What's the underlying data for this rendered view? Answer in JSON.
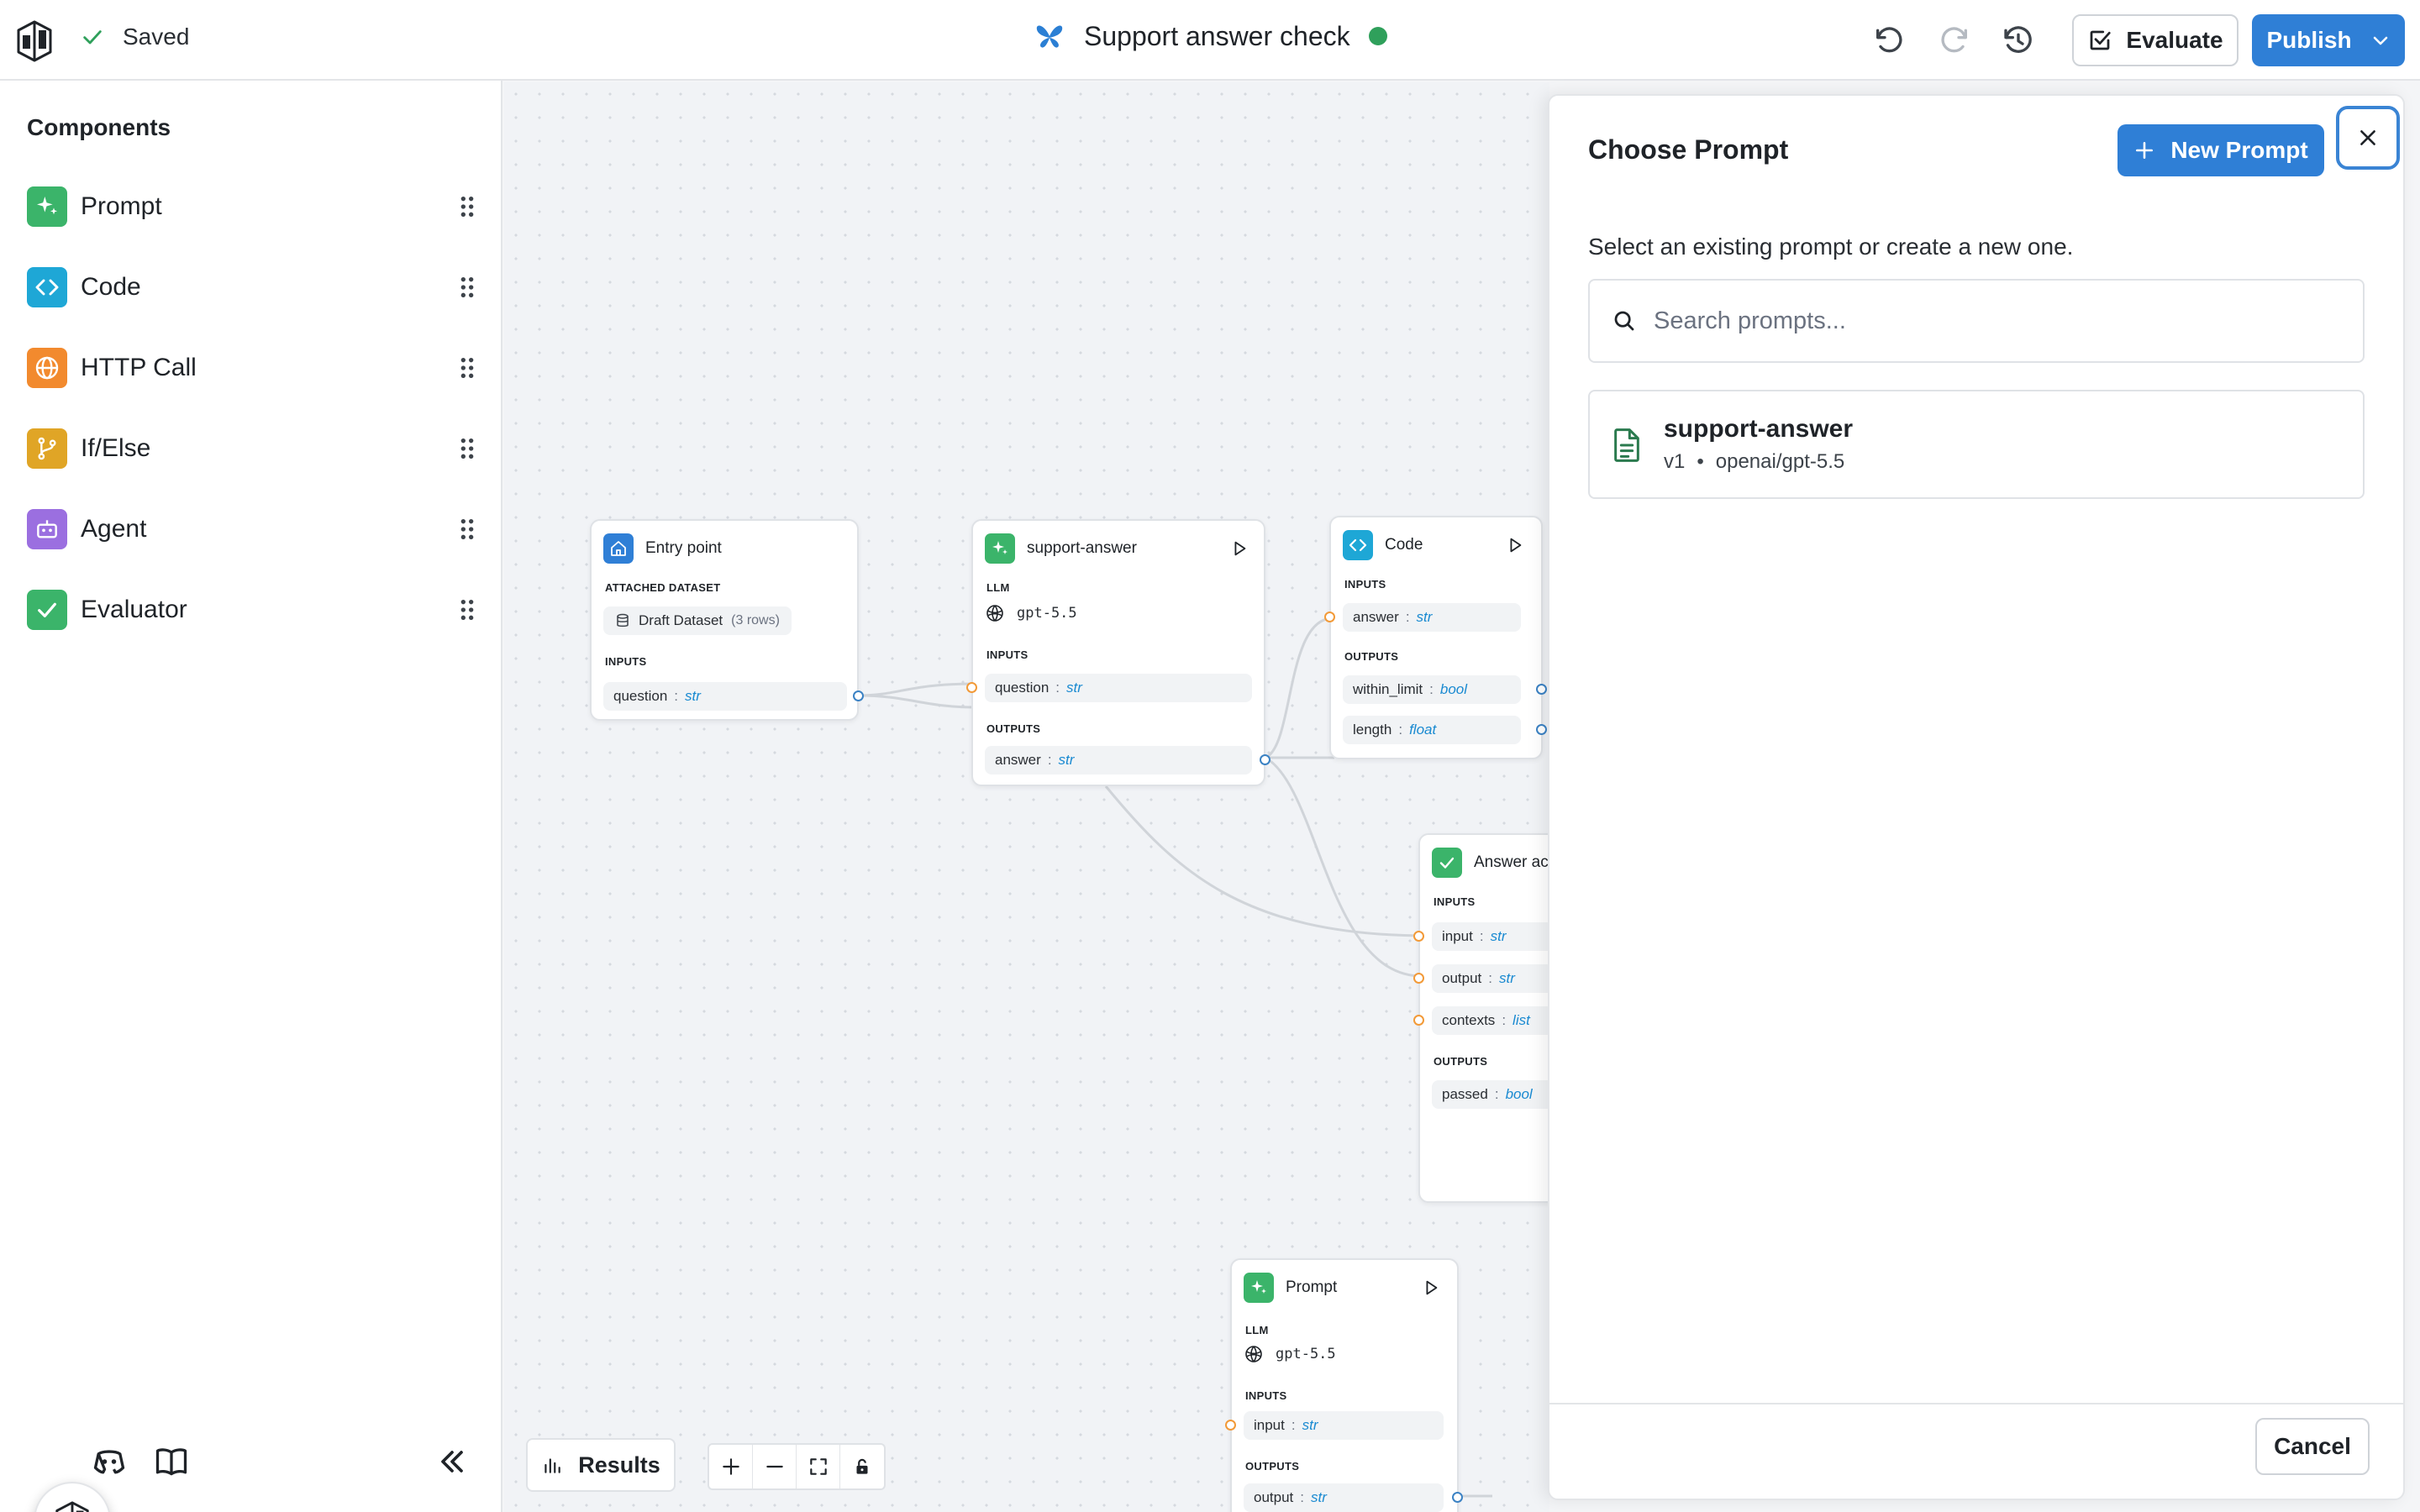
{
  "topbar": {
    "saved_label": "Saved",
    "workflow_title": "Support answer check",
    "status_color": "#2fa05b",
    "evaluate_label": "Evaluate",
    "publish_label": "Publish",
    "icons": [
      "undo-icon",
      "redo-icon",
      "history-icon"
    ]
  },
  "sidebar": {
    "title": "Components",
    "items": [
      {
        "label": "Prompt",
        "icon": "sparkle-icon",
        "color": "#3bb46a"
      },
      {
        "label": "Code",
        "icon": "code-icon",
        "color": "#1ea7d6"
      },
      {
        "label": "HTTP Call",
        "icon": "globe-icon",
        "color": "#f28a2e"
      },
      {
        "label": "If/Else",
        "icon": "branch-icon",
        "color": "#e0a526"
      },
      {
        "label": "Agent",
        "icon": "robot-icon",
        "color": "#9b6fe0"
      },
      {
        "label": "Evaluator",
        "icon": "check-icon",
        "color": "#3bb46a"
      }
    ]
  },
  "canvas": {
    "results_label": "Results",
    "nodes": {
      "entry": {
        "title": "Entry point",
        "dataset_section": "ATTACHED DATASET",
        "dataset_name": "Draft Dataset",
        "dataset_rows": "(3 rows)",
        "inputs_section": "INPUTS",
        "inputs": [
          {
            "name": "question",
            "type": "str"
          }
        ]
      },
      "support": {
        "title": "support-answer",
        "llm_section": "LLM",
        "model": "gpt-5.5",
        "inputs_section": "INPUTS",
        "inputs": [
          {
            "name": "question",
            "type": "str"
          }
        ],
        "outputs_section": "OUTPUTS",
        "outputs": [
          {
            "name": "answer",
            "type": "str"
          }
        ]
      },
      "code": {
        "title": "Code",
        "inputs_section": "INPUTS",
        "inputs": [
          {
            "name": "answer",
            "type": "str"
          }
        ],
        "outputs_section": "OUTPUTS",
        "outputs": [
          {
            "name": "within_limit",
            "type": "bool"
          },
          {
            "name": "length",
            "type": "float"
          }
        ]
      },
      "evaluator": {
        "title": "Answer ac",
        "inputs_section": "INPUTS",
        "inputs": [
          {
            "name": "input",
            "type": "str"
          },
          {
            "name": "output",
            "type": "str"
          },
          {
            "name": "contexts",
            "type": "list"
          }
        ],
        "outputs_section": "OUTPUTS",
        "outputs": [
          {
            "name": "passed",
            "type": "bool"
          }
        ]
      },
      "prompt": {
        "title": "Prompt",
        "llm_section": "LLM",
        "model": "gpt-5.5",
        "inputs_section": "INPUTS",
        "inputs": [
          {
            "name": "input",
            "type": "str"
          }
        ],
        "outputs_section": "OUTPUTS",
        "outputs": [
          {
            "name": "output",
            "type": "str"
          }
        ]
      }
    }
  },
  "panel": {
    "title": "Choose Prompt",
    "new_prompt_label": "New Prompt",
    "description": "Select an existing prompt or create a new one.",
    "search_placeholder": "Search prompts...",
    "prompts": [
      {
        "name": "support-answer",
        "version": "v1",
        "bullet": "•",
        "model": "openai/gpt-5.5"
      }
    ],
    "cancel_label": "Cancel"
  }
}
